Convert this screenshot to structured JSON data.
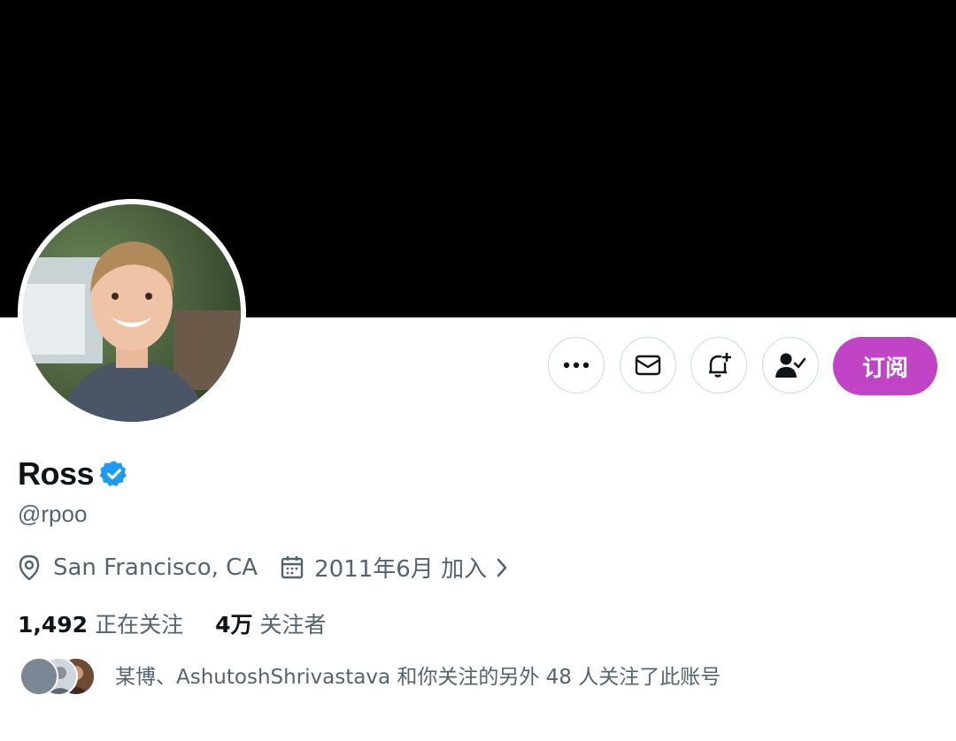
{
  "profile": {
    "display_name": "Ross",
    "handle": "@rpoo",
    "location": "San Francisco, CA",
    "joined": "2011年6月 加入",
    "following_count": "1,492",
    "following_label": "正在关注",
    "followers_count": "4万",
    "followers_label": "关注者",
    "followed_by_text": "某博、AshutoshShrivastava 和你关注的另外 48 人关注了此账号"
  },
  "actions": {
    "subscribe_label": "订阅"
  },
  "icons": {
    "more": "more-icon",
    "message": "mail-icon",
    "notify": "bell-plus-icon",
    "following": "person-check-icon",
    "verified": "verified-badge-icon",
    "location": "location-pin-icon",
    "calendar": "calendar-icon",
    "chevron": "chevron-right-icon"
  },
  "colors": {
    "accent": "#c143c6",
    "verified": "#1d9bf0",
    "secondary_text": "#536471",
    "border": "#cfd9de"
  }
}
